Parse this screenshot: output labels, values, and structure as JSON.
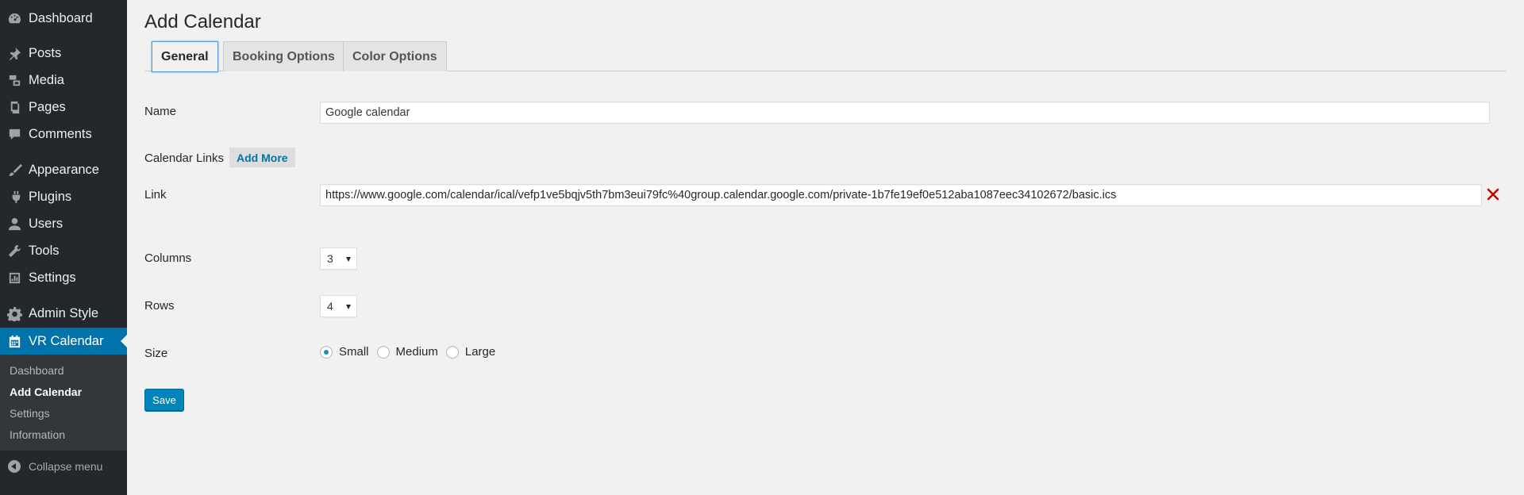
{
  "sidebar": {
    "items": [
      {
        "label": "Dashboard",
        "icon": "dashboard-icon"
      },
      {
        "label": "Posts",
        "icon": "pin-icon"
      },
      {
        "label": "Media",
        "icon": "media-icon"
      },
      {
        "label": "Pages",
        "icon": "pages-icon"
      },
      {
        "label": "Comments",
        "icon": "comment-icon"
      },
      {
        "label": "Appearance",
        "icon": "brush-icon"
      },
      {
        "label": "Plugins",
        "icon": "plug-icon"
      },
      {
        "label": "Users",
        "icon": "user-icon"
      },
      {
        "label": "Tools",
        "icon": "wrench-icon"
      },
      {
        "label": "Settings",
        "icon": "settings-icon"
      },
      {
        "label": "Admin Style",
        "icon": "gear-icon"
      },
      {
        "label": "VR Calendar",
        "icon": "calendar-icon"
      }
    ],
    "submenu": [
      "Dashboard",
      "Add Calendar",
      "Settings",
      "Information"
    ],
    "collapse_label": "Collapse menu"
  },
  "page": {
    "title": "Add Calendar",
    "tabs": [
      "General",
      "Booking Options",
      "Color Options"
    ]
  },
  "form": {
    "name_label": "Name",
    "name_value": "Google calendar",
    "calendar_links_label": "Calendar Links",
    "add_more_label": "Add More",
    "link_label": "Link",
    "link_value": "https://www.google.com/calendar/ical/vefp1ve5bqjv5th7bm3eui79fc%40group.calendar.google.com/private-1b7fe19ef0e512aba1087eec34102672/basic.ics",
    "columns_label": "Columns",
    "columns_value": "3",
    "rows_label": "Rows",
    "rows_value": "4",
    "size_label": "Size",
    "size_options": [
      "Small",
      "Medium",
      "Large"
    ],
    "size_selected": "Small",
    "save_label": "Save"
  },
  "colors": {
    "sidebar_bg": "#23282d",
    "active_menu": "#0073aa",
    "primary_button": "#0085ba",
    "remove_icon": "#cc0000"
  }
}
